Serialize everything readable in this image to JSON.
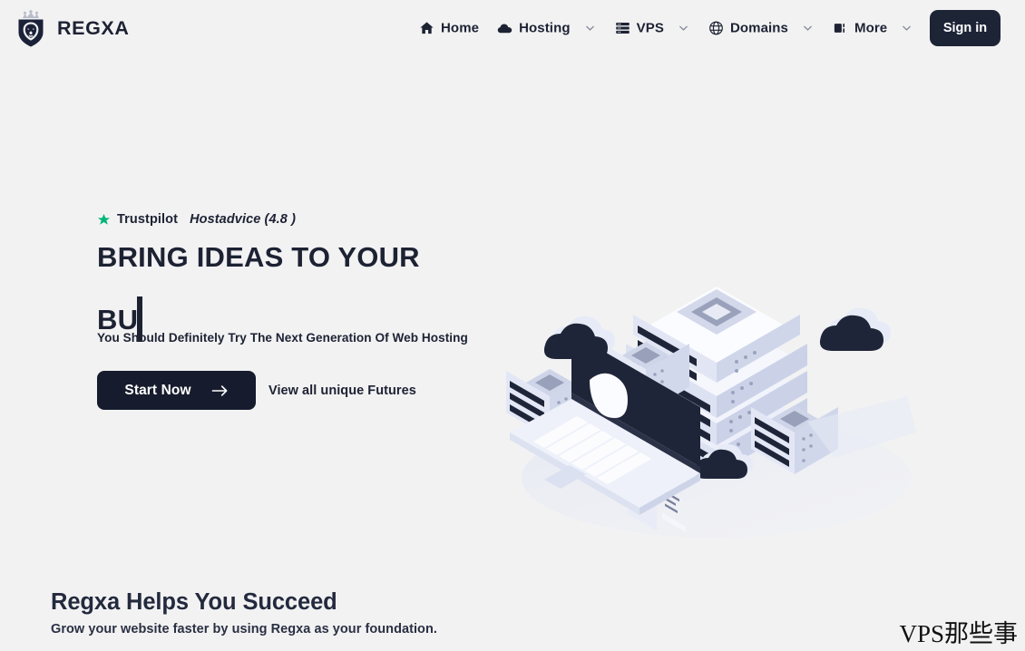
{
  "page": {
    "background_color": "#f2f2f3",
    "text_color": "#1d2233"
  },
  "header": {
    "brand": {
      "name": "REGXA",
      "logo_icon": "lion-crown-shield-logo"
    },
    "nav": [
      {
        "label": "Home",
        "icon": "home-icon",
        "has_caret": false
      },
      {
        "label": "Hosting",
        "icon": "cloud-icon",
        "has_caret": true
      },
      {
        "label": "VPS",
        "icon": "server-rack-icon",
        "has_caret": true
      },
      {
        "label": "Domains",
        "icon": "globe-icon",
        "has_caret": true
      },
      {
        "label": "More",
        "icon": "grid-list-icon",
        "has_caret": true
      }
    ],
    "signin_label": "Sign in",
    "signin_color": "#1d2436"
  },
  "hero": {
    "rating": {
      "star_icon": "star-icon",
      "star_color": "#00b67a",
      "platform": "Trustpilot",
      "secondary": "Hostadvice (4.8 )"
    },
    "title_line1": "BRING IDEAS TO YOUR",
    "title_line2_typed": "BU",
    "subtitle": "You Should Definitely Try The Next Generation Of Web Hosting",
    "cta_primary": "Start Now",
    "cta_primary_icon": "arrow-right-icon",
    "cta_primary_color": "#161c2d",
    "cta_secondary": "View all unique Futures",
    "illustration": "isometric-servers-clouds-laptop-shield"
  },
  "succeed": {
    "title": "Regxa Helps You Succeed",
    "subtitle": "Grow your website faster by using Regxa as your foundation."
  },
  "watermark": {
    "text": "VPS那些事"
  }
}
